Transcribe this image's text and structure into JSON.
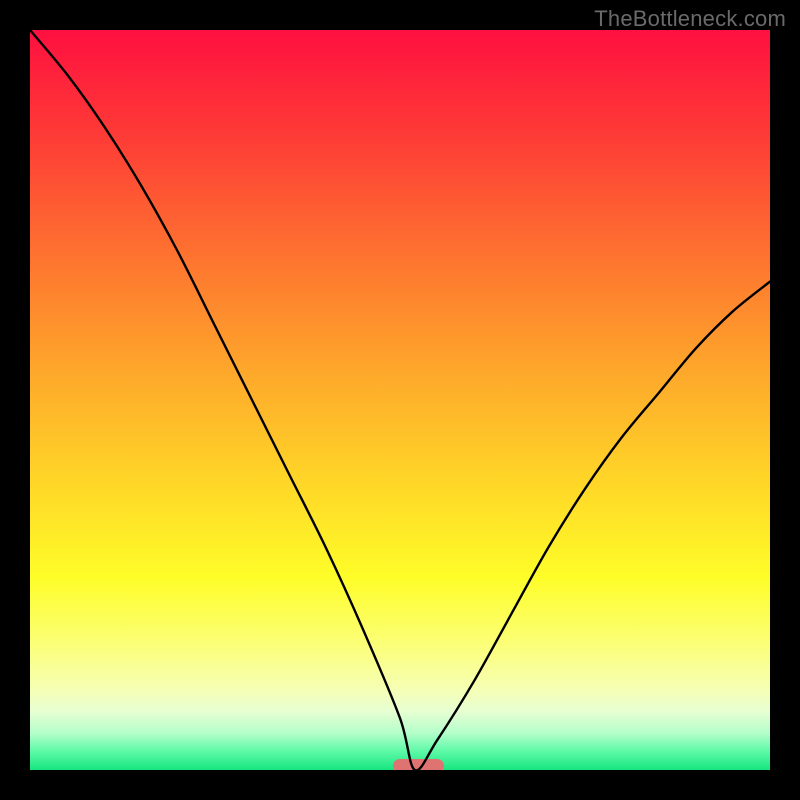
{
  "watermark": "TheBottleneck.com",
  "chart_data": {
    "type": "line",
    "title": "",
    "xlabel": "",
    "ylabel": "",
    "xlim": [
      0,
      100
    ],
    "ylim": [
      0,
      100
    ],
    "x": [
      0,
      5,
      10,
      15,
      20,
      25,
      30,
      35,
      40,
      45,
      50,
      52,
      55,
      60,
      65,
      70,
      75,
      80,
      85,
      90,
      95,
      100
    ],
    "values": [
      100,
      94,
      87,
      79,
      70,
      60,
      50,
      40,
      30,
      19,
      7,
      0,
      4,
      12,
      21,
      30,
      38,
      45,
      51,
      57,
      62,
      66
    ],
    "marker": {
      "x_start": 49,
      "x_end": 56,
      "y": 0
    },
    "gradient_stops": [
      {
        "offset": 0,
        "color": "#fe1040"
      },
      {
        "offset": 14,
        "color": "#fe3a36"
      },
      {
        "offset": 30,
        "color": "#fe7130"
      },
      {
        "offset": 46,
        "color": "#fea72b"
      },
      {
        "offset": 62,
        "color": "#ffd927"
      },
      {
        "offset": 74,
        "color": "#fefd29"
      },
      {
        "offset": 82,
        "color": "#fcff6e"
      },
      {
        "offset": 89,
        "color": "#f6ffb3"
      },
      {
        "offset": 92,
        "color": "#e8ffd2"
      },
      {
        "offset": 95,
        "color": "#b4feca"
      },
      {
        "offset": 97.5,
        "color": "#5cf9a6"
      },
      {
        "offset": 100,
        "color": "#17e580"
      }
    ]
  }
}
